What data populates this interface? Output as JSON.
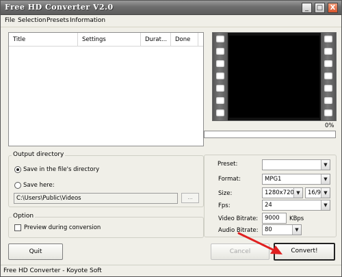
{
  "window": {
    "title": "Free HD Converter V2.0"
  },
  "titlebar_buttons": {
    "minimize": "_",
    "maximize": "□",
    "close": "X"
  },
  "menu": {
    "items": [
      "File",
      "Selection",
      "Presets",
      "Information"
    ]
  },
  "file_list": {
    "columns": [
      "Title",
      "Settings",
      "Durat...",
      "Done"
    ],
    "rows": []
  },
  "preview": {
    "progress_percent_label": "0%",
    "progress_value": 0
  },
  "output_directory": {
    "label": "Output directory",
    "save_in_file_dir": "Save in the file's directory",
    "save_here": "Save here:",
    "path": "C:\\Users\\Public\\Videos",
    "browse_label": "...",
    "selected": "save_in_file_dir"
  },
  "option": {
    "label": "Option",
    "preview_during_conversion": "Preview during conversion",
    "checked": false
  },
  "settings": {
    "preset_label": "Preset:",
    "preset_value": "",
    "format_label": "Format:",
    "format_value": "MPG1",
    "size_label": "Size:",
    "size_value": "1280x720",
    "aspect_value": "16/9",
    "fps_label": "Fps:",
    "fps_value": "24",
    "video_bitrate_label": "Video Bitrate:",
    "video_bitrate_value": "9000",
    "video_bitrate_unit": "KBps",
    "audio_bitrate_label": "Audio Bitrate:",
    "audio_bitrate_value": "80"
  },
  "buttons": {
    "quit": "Quit",
    "cancel": "Cancel",
    "convert": "Convert!"
  },
  "status": {
    "text": "Free HD Converter - Koyote Soft"
  },
  "annotation": {
    "arrow_color": "#e02020"
  }
}
